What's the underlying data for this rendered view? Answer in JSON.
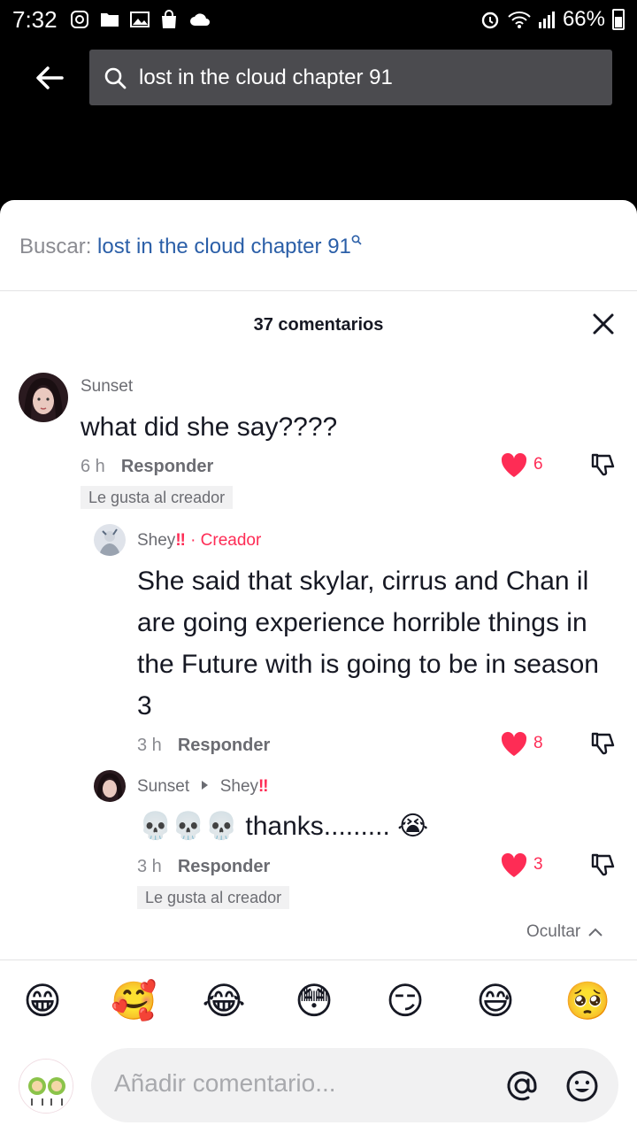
{
  "status_bar": {
    "time": "7:32",
    "battery": "66%"
  },
  "search": {
    "query": "lost in the cloud chapter 91"
  },
  "buscar": {
    "prefix": "Buscar: ",
    "query": "lost in the cloud chapter 91"
  },
  "comments_header": {
    "count_label": "37 comentarios"
  },
  "comments": [
    {
      "author": "Sunset",
      "text": "what did she say????",
      "time": "6 h",
      "reply_label": "Responder",
      "likes": "6",
      "creator_liked": "Le gusta al creador"
    }
  ],
  "replies": [
    {
      "author": "Shey",
      "author_suffix": "‼",
      "badge": "· Creador",
      "text": "She said that skylar, cirrus and Chan il are going experience horrible things in the Future with is going to be in season 3",
      "time": "3 h",
      "reply_label": "Responder",
      "likes": "8"
    },
    {
      "author": "Sunset",
      "reply_to": "Shey",
      "reply_to_suffix": "‼",
      "text": "💀💀💀 thanks......... 😭",
      "time": "3 h",
      "reply_label": "Responder",
      "likes": "3",
      "creator_liked": "Le gusta al creador"
    }
  ],
  "hide_label": "Ocultar",
  "emoji_bar": [
    "😁",
    "🥰",
    "😂",
    "😳",
    "😏",
    "😅",
    "🥺"
  ],
  "comment_input": {
    "placeholder": "Añadir comentario..."
  },
  "colors": {
    "accent": "#fe2c55",
    "link": "#2b5fa8",
    "search_bg": "#4b4b4f"
  }
}
